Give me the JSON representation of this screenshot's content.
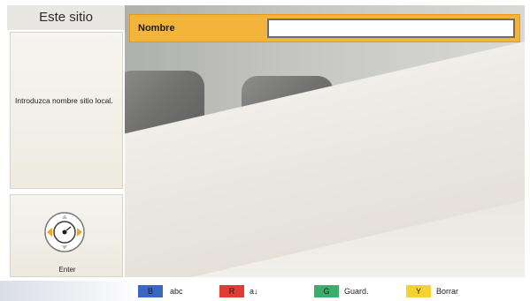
{
  "sidebar": {
    "title": "Este sitio",
    "info_text": "Introduzca nombre sitio local.",
    "nav": {
      "enter_label": "Enter"
    }
  },
  "main": {
    "name_label": "Nombre",
    "name_value": ""
  },
  "keys": [
    {
      "letter": "B",
      "label": "abc",
      "color": "#3a67c6"
    },
    {
      "letter": "R",
      "label": "a↓",
      "color": "#e23b34"
    },
    {
      "letter": "G",
      "label": "Guard.",
      "color": "#3bae6a"
    },
    {
      "letter": "Y",
      "label": "Borrar",
      "color": "#f2d32f"
    }
  ],
  "colors": {
    "accent_orange": "#f3b43c",
    "arrow_orange": "#f2a51d"
  }
}
